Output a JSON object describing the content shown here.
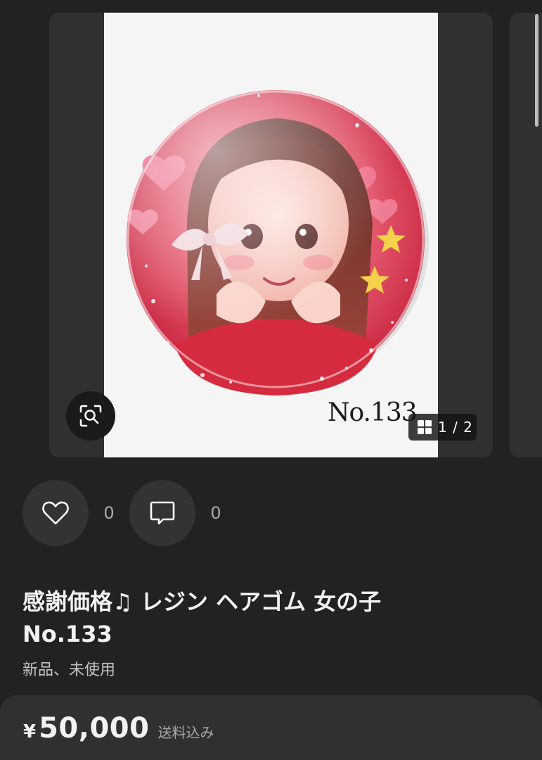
{
  "gallery": {
    "photo_caption": "No.133",
    "counter": "1 / 2",
    "icons": {
      "zoom": "zoom-scan-icon",
      "grid": "grid-icon"
    }
  },
  "actions": {
    "like_count": "0",
    "comment_count": "0",
    "icons": {
      "like": "heart-icon",
      "comment": "speech-bubble-icon"
    }
  },
  "item": {
    "title_line1": "感謝価格♫ レジン ヘアゴム 女の子",
    "title_line2": "No.133",
    "condition": "新品、未使用"
  },
  "price": {
    "currency": "¥",
    "amount": "50,000",
    "shipping_note": "送料込み"
  },
  "colors": {
    "background": "#222222",
    "card": "#303030",
    "badge_red": "#d8304a",
    "badge_pink": "#f0a7b6"
  }
}
